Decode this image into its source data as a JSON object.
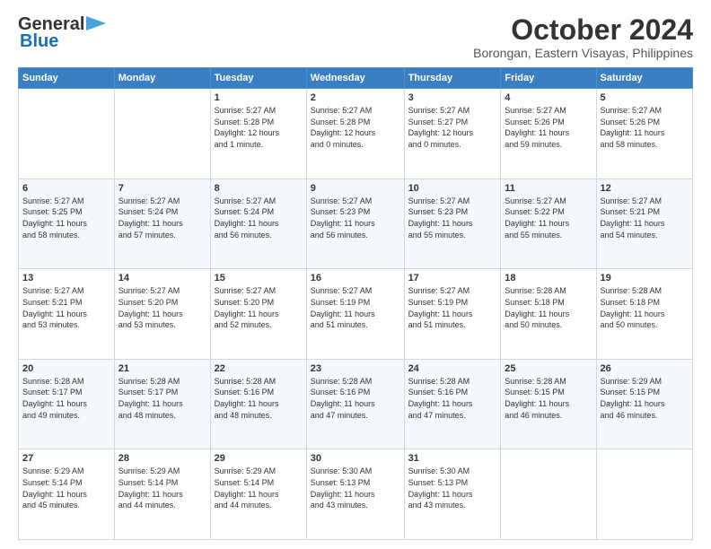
{
  "header": {
    "logo_line1": "General",
    "logo_line2": "Blue",
    "title": "October 2024",
    "subtitle": "Borongan, Eastern Visayas, Philippines"
  },
  "columns": [
    "Sunday",
    "Monday",
    "Tuesday",
    "Wednesday",
    "Thursday",
    "Friday",
    "Saturday"
  ],
  "weeks": [
    [
      {
        "day": "",
        "info": ""
      },
      {
        "day": "",
        "info": ""
      },
      {
        "day": "1",
        "info": "Sunrise: 5:27 AM\nSunset: 5:28 PM\nDaylight: 12 hours\nand 1 minute."
      },
      {
        "day": "2",
        "info": "Sunrise: 5:27 AM\nSunset: 5:28 PM\nDaylight: 12 hours\nand 0 minutes."
      },
      {
        "day": "3",
        "info": "Sunrise: 5:27 AM\nSunset: 5:27 PM\nDaylight: 12 hours\nand 0 minutes."
      },
      {
        "day": "4",
        "info": "Sunrise: 5:27 AM\nSunset: 5:26 PM\nDaylight: 11 hours\nand 59 minutes."
      },
      {
        "day": "5",
        "info": "Sunrise: 5:27 AM\nSunset: 5:26 PM\nDaylight: 11 hours\nand 58 minutes."
      }
    ],
    [
      {
        "day": "6",
        "info": "Sunrise: 5:27 AM\nSunset: 5:25 PM\nDaylight: 11 hours\nand 58 minutes."
      },
      {
        "day": "7",
        "info": "Sunrise: 5:27 AM\nSunset: 5:24 PM\nDaylight: 11 hours\nand 57 minutes."
      },
      {
        "day": "8",
        "info": "Sunrise: 5:27 AM\nSunset: 5:24 PM\nDaylight: 11 hours\nand 56 minutes."
      },
      {
        "day": "9",
        "info": "Sunrise: 5:27 AM\nSunset: 5:23 PM\nDaylight: 11 hours\nand 56 minutes."
      },
      {
        "day": "10",
        "info": "Sunrise: 5:27 AM\nSunset: 5:23 PM\nDaylight: 11 hours\nand 55 minutes."
      },
      {
        "day": "11",
        "info": "Sunrise: 5:27 AM\nSunset: 5:22 PM\nDaylight: 11 hours\nand 55 minutes."
      },
      {
        "day": "12",
        "info": "Sunrise: 5:27 AM\nSunset: 5:21 PM\nDaylight: 11 hours\nand 54 minutes."
      }
    ],
    [
      {
        "day": "13",
        "info": "Sunrise: 5:27 AM\nSunset: 5:21 PM\nDaylight: 11 hours\nand 53 minutes."
      },
      {
        "day": "14",
        "info": "Sunrise: 5:27 AM\nSunset: 5:20 PM\nDaylight: 11 hours\nand 53 minutes."
      },
      {
        "day": "15",
        "info": "Sunrise: 5:27 AM\nSunset: 5:20 PM\nDaylight: 11 hours\nand 52 minutes."
      },
      {
        "day": "16",
        "info": "Sunrise: 5:27 AM\nSunset: 5:19 PM\nDaylight: 11 hours\nand 51 minutes."
      },
      {
        "day": "17",
        "info": "Sunrise: 5:27 AM\nSunset: 5:19 PM\nDaylight: 11 hours\nand 51 minutes."
      },
      {
        "day": "18",
        "info": "Sunrise: 5:28 AM\nSunset: 5:18 PM\nDaylight: 11 hours\nand 50 minutes."
      },
      {
        "day": "19",
        "info": "Sunrise: 5:28 AM\nSunset: 5:18 PM\nDaylight: 11 hours\nand 50 minutes."
      }
    ],
    [
      {
        "day": "20",
        "info": "Sunrise: 5:28 AM\nSunset: 5:17 PM\nDaylight: 11 hours\nand 49 minutes."
      },
      {
        "day": "21",
        "info": "Sunrise: 5:28 AM\nSunset: 5:17 PM\nDaylight: 11 hours\nand 48 minutes."
      },
      {
        "day": "22",
        "info": "Sunrise: 5:28 AM\nSunset: 5:16 PM\nDaylight: 11 hours\nand 48 minutes."
      },
      {
        "day": "23",
        "info": "Sunrise: 5:28 AM\nSunset: 5:16 PM\nDaylight: 11 hours\nand 47 minutes."
      },
      {
        "day": "24",
        "info": "Sunrise: 5:28 AM\nSunset: 5:16 PM\nDaylight: 11 hours\nand 47 minutes."
      },
      {
        "day": "25",
        "info": "Sunrise: 5:28 AM\nSunset: 5:15 PM\nDaylight: 11 hours\nand 46 minutes."
      },
      {
        "day": "26",
        "info": "Sunrise: 5:29 AM\nSunset: 5:15 PM\nDaylight: 11 hours\nand 46 minutes."
      }
    ],
    [
      {
        "day": "27",
        "info": "Sunrise: 5:29 AM\nSunset: 5:14 PM\nDaylight: 11 hours\nand 45 minutes."
      },
      {
        "day": "28",
        "info": "Sunrise: 5:29 AM\nSunset: 5:14 PM\nDaylight: 11 hours\nand 44 minutes."
      },
      {
        "day": "29",
        "info": "Sunrise: 5:29 AM\nSunset: 5:14 PM\nDaylight: 11 hours\nand 44 minutes."
      },
      {
        "day": "30",
        "info": "Sunrise: 5:30 AM\nSunset: 5:13 PM\nDaylight: 11 hours\nand 43 minutes."
      },
      {
        "day": "31",
        "info": "Sunrise: 5:30 AM\nSunset: 5:13 PM\nDaylight: 11 hours\nand 43 minutes."
      },
      {
        "day": "",
        "info": ""
      },
      {
        "day": "",
        "info": ""
      }
    ]
  ]
}
